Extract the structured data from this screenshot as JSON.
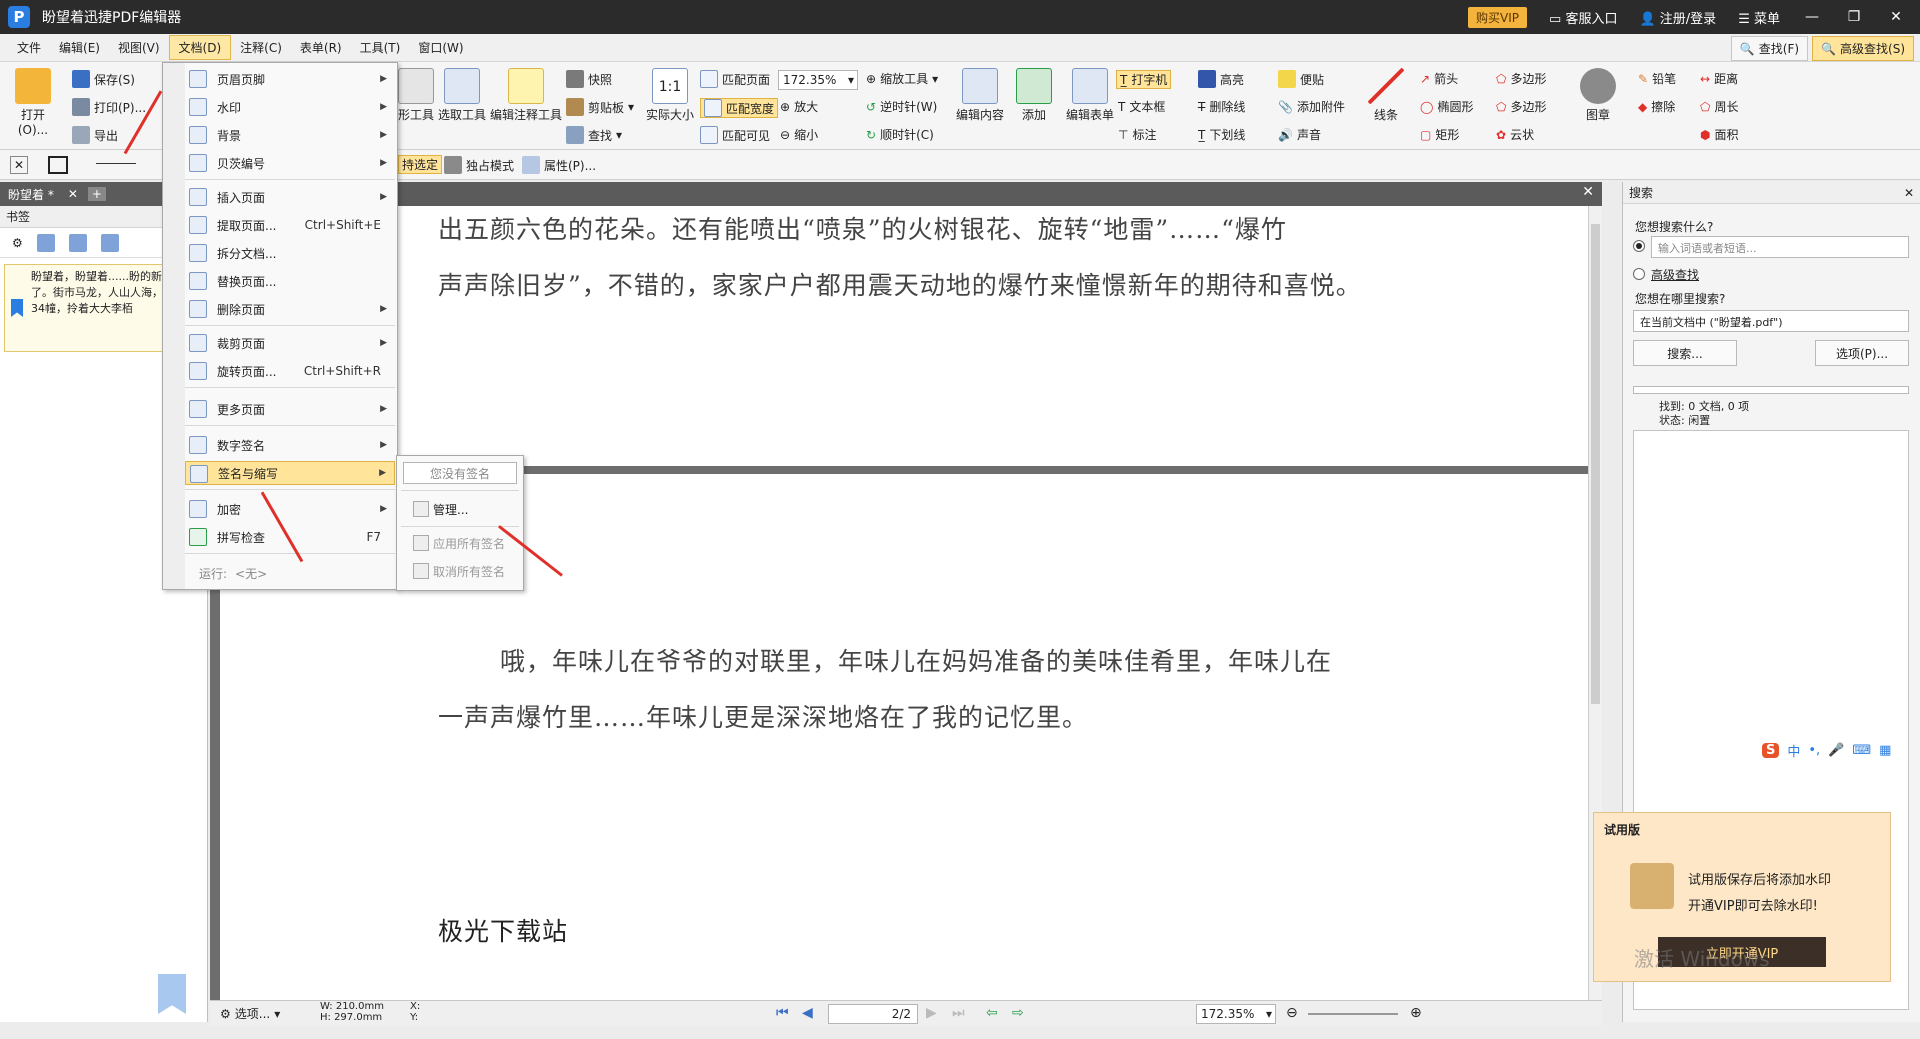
{
  "titlebar": {
    "title": "盼望着迅捷PDF编辑器",
    "vip": "购买VIP",
    "service": "客服入口",
    "login": "注册/登录",
    "menu": "菜单"
  },
  "menubar": {
    "items": [
      "文件",
      "编辑(E)",
      "视图(V)",
      "文档(D)",
      "注释(C)",
      "表单(R)",
      "工具(T)",
      "窗口(W)"
    ],
    "find": "查找(F)",
    "advanced_find": "高级查找(S)"
  },
  "ribbon": {
    "open": "打开(O)...",
    "save": "保存(S)",
    "print": "打印(P)...",
    "export": "导出",
    "hand_tool": "形工具",
    "select_tool": "选取工具",
    "edit_annot_tool": "编辑注释工具",
    "snapshot": "快照",
    "clipboard": "剪贴板",
    "find": "查找",
    "actual_size": "实际大小",
    "fit_page": "匹配页面",
    "fit_width": "匹配宽度",
    "fit_visible": "匹配可见",
    "zoom_value": "172.35%",
    "zoom_in": "放大",
    "zoom_out": "缩小",
    "zoom_tool": "缩放工具",
    "ccw": "逆时针(W)",
    "cw": "顺时针(C)",
    "edit_content": "编辑内容",
    "add": "添加",
    "edit_form": "编辑表单",
    "typewriter": "打字机",
    "textbox": "文本框",
    "callout": "标注",
    "highlight": "高亮",
    "strikeout": "删除线",
    "underline": "下划线",
    "note": "便贴",
    "attach": "添加附件",
    "sound": "声音",
    "line": "线条",
    "arrow": "箭头",
    "ellipse": "椭圆形",
    "rect": "矩形",
    "polygon": "多边形",
    "polyline": "多边形",
    "cloud": "云状",
    "stamp": "图章",
    "pencil": "铅笔",
    "eraser": "擦除",
    "distance": "距离",
    "perimeter": "周长",
    "area": "面积",
    "select_mode": "持选定",
    "exclusive_mode": "独占模式",
    "properties": "属性(P)..."
  },
  "leftpanel": {
    "tab": "盼望着 *",
    "heading": "书签",
    "bookmark_text": "盼望着，盼望着......盼的新年近了。街市马龙，人山人海，好闹。34幢，拎着大大李栢"
  },
  "document": {
    "line1": "出五颜六色的花朵。还有能喷出“喷泉”的火树银花、旋转“地雷”……“爆竹",
    "line2": "声声除旧岁”，不错的，家家户户都用震天动地的爆竹来憧憬新年的期待和喜悦。",
    "line3": "哦，年味儿在爷爷的对联里，年味儿在妈妈准备的美味佳肴里，年味儿在",
    "line4": "一声声爆竹里……年味儿更是深深地烙在了我的记忆里。",
    "line5": "极光下载站"
  },
  "rightpanel": {
    "title": "搜索",
    "q1": "您想搜索什么?",
    "placeholder": "输入词语或者短语...",
    "advanced": "高级查找",
    "q2": "您想在哪里搜索?",
    "scope": "在当前文档中 (\"盼望着.pdf\")",
    "search_btn": "搜索...",
    "options_btn": "选项(P)...",
    "found": "找到: 0 文档, 0 项",
    "status": "状态: 闲置"
  },
  "statusbar": {
    "options": "选项...",
    "w": "W: 210.0mm",
    "h": "H: 297.0mm",
    "x": "X:",
    "y": "Y:",
    "page": "2/2",
    "zoom": "172.35%"
  },
  "mainmenu": {
    "items": [
      {
        "label": "页眉页脚",
        "arrow": "▶"
      },
      {
        "label": "水印",
        "arrow": "▶"
      },
      {
        "label": "背景",
        "arrow": "▶"
      },
      {
        "label": "贝茨编号",
        "arrow": "▶"
      },
      {
        "label": "插入页面",
        "arrow": "▶"
      },
      {
        "label": "提取页面...",
        "shortcut": "Ctrl+Shift+E"
      },
      {
        "label": "拆分文档..."
      },
      {
        "label": "替换页面..."
      },
      {
        "label": "删除页面",
        "arrow": "▶"
      },
      {
        "label": "裁剪页面",
        "arrow": "▶"
      },
      {
        "label": "旋转页面...",
        "shortcut": "Ctrl+Shift+R"
      },
      {
        "label": "更多页面",
        "arrow": "▶"
      },
      {
        "label": "数字签名",
        "arrow": "▶"
      },
      {
        "label": "签名与缩写",
        "arrow": "▶"
      },
      {
        "label": "加密",
        "arrow": "▶"
      },
      {
        "label": "拼写检查",
        "shortcut": "F7"
      }
    ],
    "run": "运行:",
    "run_value": "<无>"
  },
  "submenu": {
    "no_signature": "您没有签名",
    "manage": "管理...",
    "apply_all": "应用所有签名",
    "cancel_all": "取消所有签名"
  },
  "trial": {
    "title": "试用版",
    "line1": "试用版保存后将添加水印",
    "line2": "开通VIP即可去除水印!",
    "button": "立即开通VIP",
    "watermark": "激活 Windows"
  },
  "ime": {
    "label": "中"
  },
  "colors": {
    "accent": "#2a7de1",
    "highlight": "#ffe49a",
    "arrow": "#e0302a"
  }
}
